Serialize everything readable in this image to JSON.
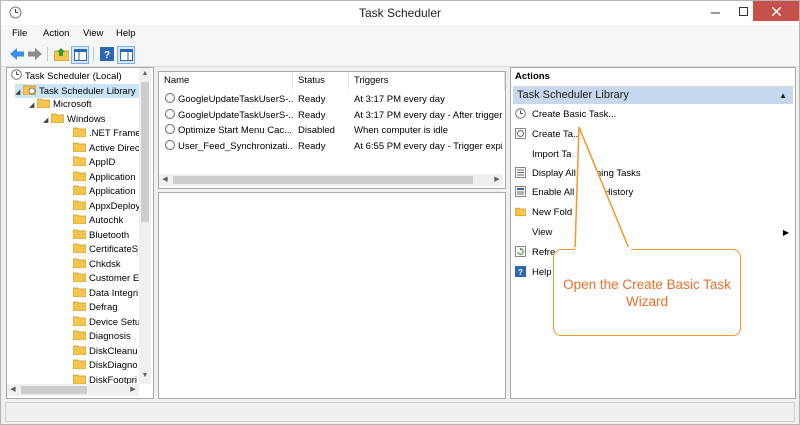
{
  "window": {
    "title": "Task Scheduler"
  },
  "menu": [
    "File",
    "Action",
    "View",
    "Help"
  ],
  "tree": {
    "root": "Task Scheduler (Local)",
    "library": "Task Scheduler Library",
    "microsoft": "Microsoft",
    "windows": "Windows",
    "folders": [
      ".NET Frame",
      "Active Direc",
      "AppID",
      "Application",
      "Application",
      "AppxDeploy",
      "Autochk",
      "Bluetooth",
      "CertificateS",
      "Chkdsk",
      "Customer E",
      "Data Integri",
      "Defrag",
      "Device Setu",
      "Diagnosis",
      "DiskCleanu",
      "DiskDiagno",
      "DiskFootpri"
    ]
  },
  "task_list": {
    "columns": [
      "Name",
      "Status",
      "Triggers"
    ],
    "rows": [
      {
        "name": "GoogleUpdateTaskUserS-...",
        "status": "Ready",
        "trigger": "At 3:17 PM every day"
      },
      {
        "name": "GoogleUpdateTaskUserS-...",
        "status": "Ready",
        "trigger": "At 3:17 PM every day - After trigger"
      },
      {
        "name": "Optimize Start Menu Cac...",
        "status": "Disabled",
        "trigger": "When computer is idle"
      },
      {
        "name": "User_Feed_Synchronizati...",
        "status": "Ready",
        "trigger": "At 6:55 PM every day - Trigger expir"
      }
    ]
  },
  "actions": {
    "header": "Actions",
    "section": "Task Scheduler Library",
    "items": [
      "Create Basic Task...",
      "Create Ta...",
      "Import Ta",
      "Display All Running Tasks",
      "Enable All Tasks History",
      "New Fold",
      "View",
      "Refre",
      "Help"
    ]
  },
  "callout": {
    "text": "Open the Create Basic Task Wizard"
  },
  "colors": {
    "accent": "#f39528",
    "callout_text": "#e8702a",
    "section_bg": "#c5d8ee",
    "close_bg": "#c7504b"
  }
}
